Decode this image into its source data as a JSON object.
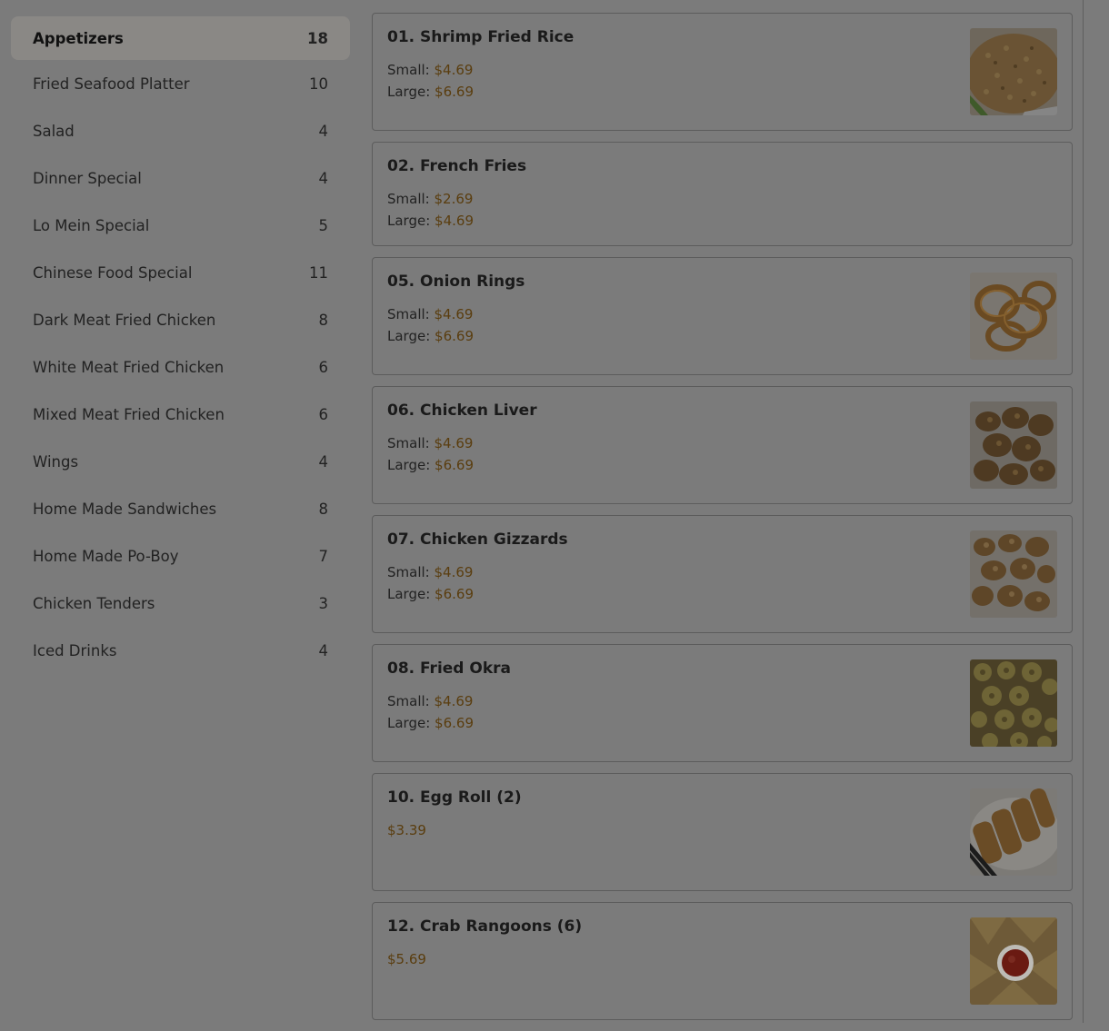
{
  "categories": [
    {
      "label": "Appetizers",
      "count": "18"
    },
    {
      "label": "Fried Seafood Platter",
      "count": "10"
    },
    {
      "label": "Salad",
      "count": "4"
    },
    {
      "label": "Dinner Special",
      "count": "4"
    },
    {
      "label": "Lo Mein Special",
      "count": "5"
    },
    {
      "label": "Chinese Food Special",
      "count": "11"
    },
    {
      "label": "Dark Meat Fried Chicken",
      "count": "8"
    },
    {
      "label": "White Meat Fried Chicken",
      "count": "6"
    },
    {
      "label": "Mixed Meat Fried Chicken",
      "count": "6"
    },
    {
      "label": "Wings",
      "count": "4"
    },
    {
      "label": "Home Made Sandwiches",
      "count": "8"
    },
    {
      "label": "Home Made Po-Boy",
      "count": "7"
    },
    {
      "label": "Chicken Tenders",
      "count": "3"
    },
    {
      "label": "Iced Drinks",
      "count": "4"
    }
  ],
  "items": [
    {
      "name": "01. Shrimp Fried Rice",
      "small_label": "Small:",
      "small": "$4.69",
      "large_label": "Large:",
      "large": "$6.69"
    },
    {
      "name": "02. French Fries",
      "small_label": "Small:",
      "small": "$2.69",
      "large_label": "Large:",
      "large": "$4.69"
    },
    {
      "name": "05. Onion Rings",
      "small_label": "Small:",
      "small": "$4.69",
      "large_label": "Large:",
      "large": "$6.69"
    },
    {
      "name": "06. Chicken Liver",
      "small_label": "Small:",
      "small": "$4.69",
      "large_label": "Large:",
      "large": "$6.69"
    },
    {
      "name": "07. Chicken Gizzards",
      "small_label": "Small:",
      "small": "$4.69",
      "large_label": "Large:",
      "large": "$6.69"
    },
    {
      "name": "08. Fried Okra",
      "small_label": "Small:",
      "small": "$4.69",
      "large_label": "Large:",
      "large": "$6.69"
    },
    {
      "name": "10. Egg Roll (2)",
      "price": "$3.39"
    },
    {
      "name": "12. Crab Rangoons (6)",
      "price": "$5.69"
    }
  ],
  "colors": {
    "overlay_bg": "#7b7b7b",
    "price": "#5a3d0e",
    "active_bg": "#8a8885"
  }
}
